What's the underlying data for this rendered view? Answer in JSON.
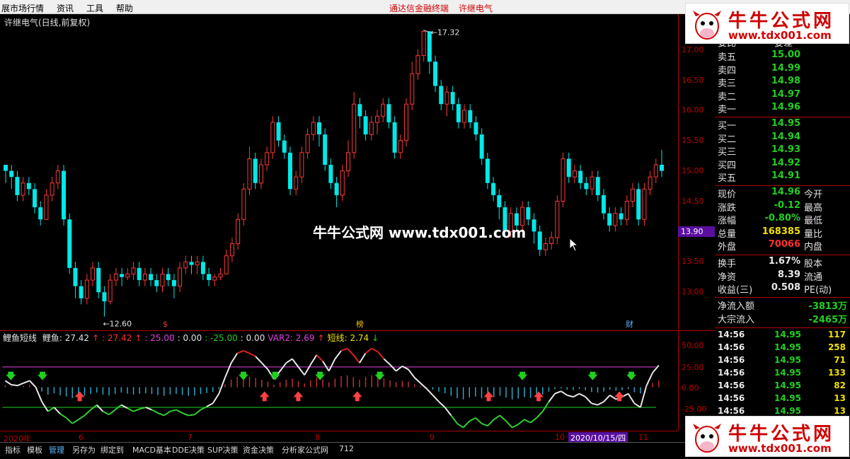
{
  "menu": {
    "items": [
      "展市场行情",
      "资讯",
      "工具",
      "帮助"
    ],
    "promo": "通达信金融终端",
    "promo_stock": "许继电气",
    "window_buttons": [
      "◇",
      "□"
    ]
  },
  "chart": {
    "title": "许继电气(日线,前复权)",
    "high_label": "17.32",
    "low_label": "12.60",
    "current_price_tag": "13.90",
    "center_watermark": "牛牛公式网 www.tdx001.com",
    "price_ticks": [
      "17.00",
      "16.50",
      "16.00",
      "15.50",
      "15.00",
      "14.50",
      "13.50",
      "13.00"
    ],
    "event_markers": [
      {
        "label": "$",
        "color": "#ff3030"
      },
      {
        "label": "榜",
        "color": "#f0c000"
      },
      {
        "label": "财",
        "color": "#5bb8ff"
      }
    ],
    "candles": [
      [
        15.1,
        15.0,
        15.1,
        14.8
      ],
      [
        15.0,
        14.9,
        15.1,
        14.7
      ],
      [
        14.9,
        14.6,
        15.0,
        14.5
      ],
      [
        14.6,
        14.8,
        14.9,
        14.5
      ],
      [
        14.8,
        14.7,
        14.9,
        14.6
      ],
      [
        14.7,
        14.4,
        14.8,
        14.3
      ],
      [
        14.4,
        14.2,
        14.5,
        14.1
      ],
      [
        14.2,
        14.6,
        14.7,
        14.2
      ],
      [
        14.6,
        14.8,
        14.9,
        14.5
      ],
      [
        14.8,
        15.0,
        15.1,
        14.7
      ],
      [
        15.0,
        14.2,
        15.1,
        14.1
      ],
      [
        14.2,
        13.4,
        14.3,
        13.3
      ],
      [
        13.4,
        13.1,
        13.5,
        12.9
      ],
      [
        13.1,
        12.9,
        13.2,
        12.8
      ],
      [
        12.9,
        13.2,
        13.3,
        12.8
      ],
      [
        13.2,
        13.4,
        13.5,
        13.1
      ],
      [
        13.4,
        13.0,
        13.5,
        12.9
      ],
      [
        13.0,
        12.85,
        13.1,
        12.6
      ],
      [
        12.85,
        13.2,
        13.3,
        12.8
      ],
      [
        13.2,
        13.3,
        13.4,
        13.1
      ],
      [
        13.3,
        13.25,
        13.4,
        13.1
      ],
      [
        13.25,
        13.3,
        13.4,
        13.2
      ],
      [
        13.3,
        13.4,
        13.5,
        13.2
      ],
      [
        13.4,
        13.2,
        13.5,
        13.1
      ],
      [
        13.2,
        13.3,
        13.4,
        13.1
      ],
      [
        13.3,
        13.2,
        13.4,
        13.1
      ],
      [
        13.2,
        13.1,
        13.3,
        13.0
      ],
      [
        13.1,
        13.3,
        13.4,
        13.0
      ],
      [
        13.3,
        13.2,
        13.4,
        13.1
      ],
      [
        13.2,
        13.1,
        13.3,
        12.9
      ],
      [
        13.1,
        13.4,
        13.5,
        13.0
      ],
      [
        13.4,
        13.5,
        13.6,
        13.3
      ],
      [
        13.5,
        13.45,
        13.6,
        13.3
      ],
      [
        13.45,
        13.5,
        13.6,
        13.3
      ],
      [
        13.5,
        13.3,
        13.6,
        13.2
      ],
      [
        13.3,
        13.2,
        13.4,
        13.1
      ],
      [
        13.2,
        13.25,
        13.3,
        13.1
      ],
      [
        13.25,
        13.3,
        13.4,
        13.2
      ],
      [
        13.3,
        13.6,
        13.7,
        13.3
      ],
      [
        13.6,
        13.8,
        13.9,
        13.5
      ],
      [
        13.8,
        14.2,
        14.3,
        13.7
      ],
      [
        14.2,
        14.7,
        14.8,
        14.1
      ],
      [
        14.7,
        15.2,
        15.4,
        14.6
      ],
      [
        15.2,
        14.8,
        15.3,
        14.7
      ],
      [
        14.8,
        15.1,
        15.2,
        14.7
      ],
      [
        15.1,
        15.3,
        15.4,
        15.0
      ],
      [
        15.3,
        15.8,
        15.9,
        15.2
      ],
      [
        15.8,
        15.5,
        15.9,
        15.4
      ],
      [
        15.5,
        15.3,
        15.6,
        15.2
      ],
      [
        15.3,
        14.7,
        15.4,
        14.6
      ],
      [
        14.7,
        14.9,
        15.0,
        14.6
      ],
      [
        14.9,
        15.3,
        15.4,
        14.8
      ],
      [
        15.3,
        15.6,
        15.7,
        15.2
      ],
      [
        15.6,
        15.8,
        15.9,
        15.5
      ],
      [
        15.8,
        15.6,
        15.9,
        15.4
      ],
      [
        15.6,
        15.1,
        15.7,
        15.0
      ],
      [
        15.1,
        14.8,
        15.2,
        14.7
      ],
      [
        14.8,
        14.6,
        14.9,
        14.4
      ],
      [
        14.6,
        15.0,
        15.1,
        14.5
      ],
      [
        15.0,
        15.3,
        15.5,
        14.9
      ],
      [
        15.3,
        16.1,
        16.3,
        15.2
      ],
      [
        16.1,
        15.9,
        16.2,
        15.7
      ],
      [
        15.9,
        15.6,
        16.0,
        15.5
      ],
      [
        15.6,
        15.8,
        15.9,
        15.5
      ],
      [
        15.8,
        15.9,
        16.0,
        15.6
      ],
      [
        15.9,
        16.1,
        16.2,
        15.8
      ],
      [
        16.1,
        15.8,
        16.2,
        15.7
      ],
      [
        15.8,
        15.3,
        15.9,
        15.2
      ],
      [
        15.3,
        15.5,
        15.6,
        15.2
      ],
      [
        15.5,
        16.1,
        16.2,
        15.4
      ],
      [
        16.1,
        16.6,
        16.8,
        16.0
      ],
      [
        16.6,
        16.9,
        17.0,
        16.5
      ],
      [
        16.9,
        17.3,
        17.32,
        16.8
      ],
      [
        17.3,
        16.8,
        17.3,
        16.6
      ],
      [
        16.8,
        16.4,
        16.9,
        16.3
      ],
      [
        16.4,
        16.1,
        16.5,
        16.0
      ],
      [
        16.1,
        16.3,
        16.4,
        15.9
      ],
      [
        16.3,
        16.1,
        16.4,
        16.0
      ],
      [
        16.1,
        15.8,
        16.2,
        15.7
      ],
      [
        15.8,
        16.0,
        16.1,
        15.7
      ],
      [
        16.0,
        15.8,
        16.1,
        15.7
      ],
      [
        15.8,
        15.6,
        15.9,
        15.5
      ],
      [
        15.6,
        15.2,
        15.7,
        15.1
      ],
      [
        15.2,
        14.8,
        15.3,
        14.7
      ],
      [
        14.8,
        14.6,
        14.9,
        14.5
      ],
      [
        14.6,
        14.4,
        14.7,
        14.2
      ],
      [
        14.4,
        14.0,
        14.5,
        13.9
      ],
      [
        14.0,
        14.3,
        14.4,
        13.9
      ],
      [
        14.3,
        14.1,
        14.4,
        14.0
      ],
      [
        14.1,
        14.4,
        14.5,
        14.0
      ],
      [
        14.4,
        14.2,
        14.5,
        14.1
      ],
      [
        14.2,
        14.0,
        14.3,
        13.8
      ],
      [
        14.0,
        13.7,
        14.1,
        13.6
      ],
      [
        13.7,
        13.8,
        13.9,
        13.6
      ],
      [
        13.8,
        13.9,
        14.0,
        13.7
      ],
      [
        13.9,
        14.5,
        14.6,
        13.8
      ],
      [
        14.5,
        15.2,
        15.3,
        14.4
      ],
      [
        15.2,
        14.9,
        15.3,
        14.8
      ],
      [
        14.9,
        15.0,
        15.1,
        14.8
      ],
      [
        15.0,
        14.8,
        15.1,
        14.7
      ],
      [
        14.8,
        14.7,
        14.9,
        14.6
      ],
      [
        14.7,
        14.9,
        15.0,
        14.6
      ],
      [
        14.9,
        14.6,
        15.0,
        14.5
      ],
      [
        14.6,
        14.3,
        14.7,
        14.2
      ],
      [
        14.3,
        14.1,
        14.4,
        14.0
      ],
      [
        14.1,
        14.3,
        14.4,
        14.0
      ],
      [
        14.3,
        14.2,
        14.4,
        14.1
      ],
      [
        14.2,
        14.5,
        14.6,
        14.1
      ],
      [
        14.5,
        14.7,
        14.8,
        14.4
      ],
      [
        14.7,
        14.2,
        14.8,
        14.1
      ],
      [
        14.2,
        14.7,
        14.8,
        14.1
      ],
      [
        14.7,
        14.9,
        15.0,
        14.6
      ],
      [
        14.9,
        15.1,
        15.2,
        14.8
      ],
      [
        15.1,
        15.0,
        15.35,
        14.9
      ]
    ],
    "mouse_cursor_icon": "arrow-cursor-icon"
  },
  "indicator": {
    "name": "鲤鱼短线",
    "items": [
      {
        "text": "鲤鱼: 27.42",
        "color": "#e0e0e0"
      },
      {
        "text": "↑",
        "color": "#ff3030"
      },
      {
        "text": ": 27.42",
        "color": "#ff3030"
      },
      {
        "text": "↑",
        "color": "#ff3030"
      },
      {
        "text": ": 25.00",
        "color": "#e040e0"
      },
      {
        "text": ": 0.00",
        "color": "#e0e0e0"
      },
      {
        "text": ": -25.00",
        "color": "#20d020"
      },
      {
        "text": ": 0.00",
        "color": "#e0e0e0"
      },
      {
        "text": "VAR2: 2.69",
        "color": "#e040e0"
      },
      {
        "text": "↑",
        "color": "#ff3030"
      },
      {
        "text": "短线: 2.74",
        "color": "#f0e000"
      },
      {
        "text": "↓",
        "color": "#20d020"
      }
    ],
    "axis_ticks": [
      "50.00",
      "25.00",
      "0.00",
      "-25.00"
    ]
  },
  "dates": {
    "labels": [
      "2020年",
      "6",
      "7",
      "8",
      "9",
      "10",
      "11"
    ],
    "selected": "2020/10/15/四"
  },
  "tabs": [
    {
      "label": "指标",
      "active": false
    },
    {
      "label": "模板",
      "active": false
    },
    {
      "label": "管理",
      "active": true
    },
    {
      "label": "另存为",
      "active": false
    },
    {
      "label": "绑定到",
      "active": false
    },
    {
      "label": "MACD基本",
      "active": false
    },
    {
      "label": "DDE决策",
      "active": false
    },
    {
      "label": "SUP决策",
      "active": false
    },
    {
      "label": "资金决策",
      "active": false
    },
    {
      "label": "分析家公式网",
      "active": false
    },
    {
      "label": "712",
      "active": false
    }
  ],
  "quote": {
    "header_left": "委比",
    "header_right": "委差",
    "asks": [
      {
        "label": "卖五",
        "price": "15.00"
      },
      {
        "label": "卖四",
        "price": "14.99"
      },
      {
        "label": "卖三",
        "price": "14.98"
      },
      {
        "label": "卖二",
        "price": "14.97"
      },
      {
        "label": "卖一",
        "price": "14.96"
      }
    ],
    "bids": [
      {
        "label": "买一",
        "price": "14.95"
      },
      {
        "label": "买二",
        "price": "14.94"
      },
      {
        "label": "买三",
        "price": "14.93"
      },
      {
        "label": "买四",
        "price": "14.92"
      },
      {
        "label": "买五",
        "price": "14.91"
      }
    ],
    "stats": [
      {
        "label": "现价",
        "value": "14.96",
        "color": "green",
        "label2": "今开"
      },
      {
        "label": "涨跌",
        "value": "-0.12",
        "color": "green",
        "label2": "最高"
      },
      {
        "label": "涨幅",
        "value": "-0.80%",
        "color": "green",
        "label2": "最低"
      },
      {
        "label": "总量",
        "value": "168385",
        "color": "yellow",
        "label2": "量比"
      },
      {
        "label": "外盘",
        "value": "70066",
        "color": "red",
        "label2": "内盘"
      }
    ],
    "stats2": [
      {
        "label": "换手",
        "value": "1.67%",
        "color": "white",
        "label2": "股本"
      },
      {
        "label": "净资",
        "value": "8.39",
        "color": "white",
        "label2": "流通"
      },
      {
        "label": "收益(三)",
        "value": "0.508",
        "color": "white",
        "label2": "PE(动)"
      }
    ],
    "flows": [
      {
        "label": "净流入额",
        "value": "-3813万"
      },
      {
        "label": "大宗流入",
        "value": "-2465万"
      }
    ],
    "ticks": [
      {
        "time": "14:56",
        "price": "14.95",
        "vol": "117"
      },
      {
        "time": "14:56",
        "price": "14.95",
        "vol": "258"
      },
      {
        "time": "14:56",
        "price": "14.95",
        "vol": "71"
      },
      {
        "time": "14:56",
        "price": "14.95",
        "vol": "133"
      },
      {
        "time": "14:56",
        "price": "14.95",
        "vol": "82"
      },
      {
        "time": "14:56",
        "price": "14.95",
        "vol": "13"
      },
      {
        "time": "14:56",
        "price": "14.95",
        "vol": "13"
      }
    ]
  },
  "watermark": {
    "title": "牛牛公式网",
    "url": "www.tdx001.com"
  }
}
